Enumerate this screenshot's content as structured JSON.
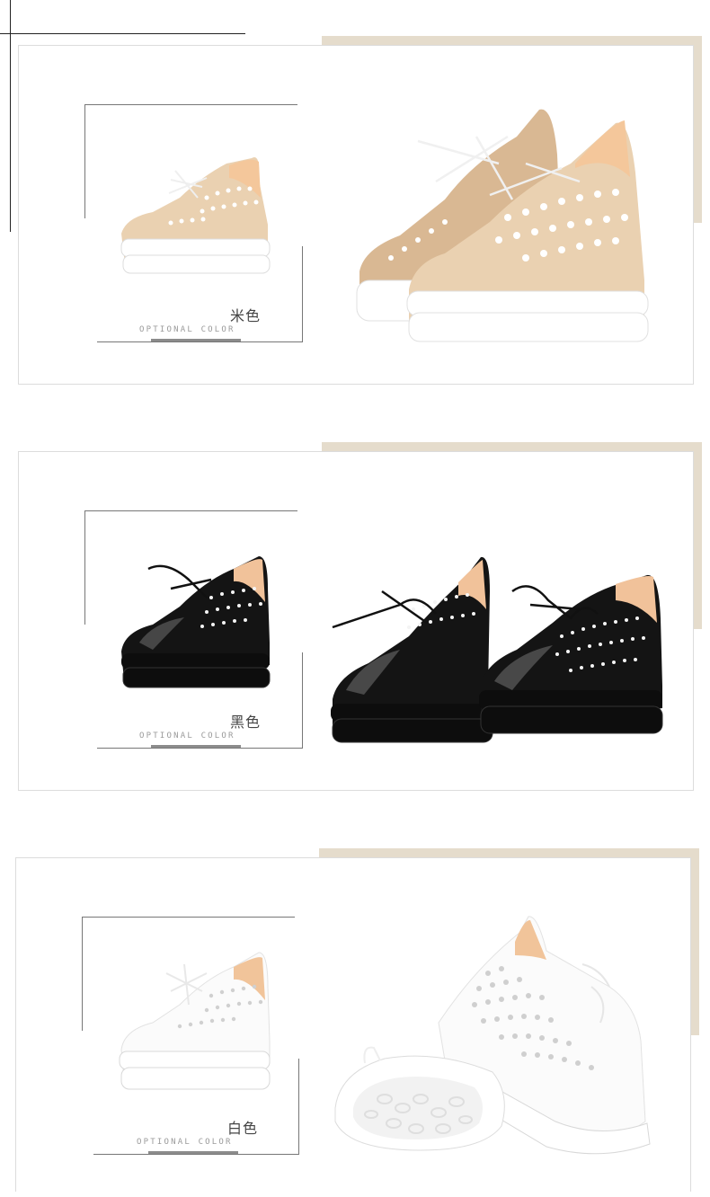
{
  "panels": [
    {
      "color_name": "米色",
      "caption": "OPTIONAL COLOR",
      "colors": {
        "upper": "#ead1b1",
        "upper_shade": "#d9b893",
        "lining": "#f4c79b",
        "sole": "#ffffff",
        "lace": "#efefef",
        "hole": "#ffffff"
      }
    },
    {
      "color_name": "黑色",
      "caption": "OPTIONAL COLOR",
      "colors": {
        "upper": "#141414",
        "upper_shade": "#2c2c2c",
        "lining": "#f1c29a",
        "sole": "#0d0d0d",
        "lace": "#111111",
        "hole": "#f4f4f4"
      }
    },
    {
      "color_name": "白色",
      "caption": "OPTIONAL COLOR",
      "colors": {
        "upper": "#fbfbfb",
        "upper_shade": "#e6e6e6",
        "lining": "#f1c49a",
        "sole": "#ffffff",
        "lace": "#f2f2f2",
        "hole": "#d8d8d8"
      }
    }
  ],
  "accent_color": "#e5dccc"
}
